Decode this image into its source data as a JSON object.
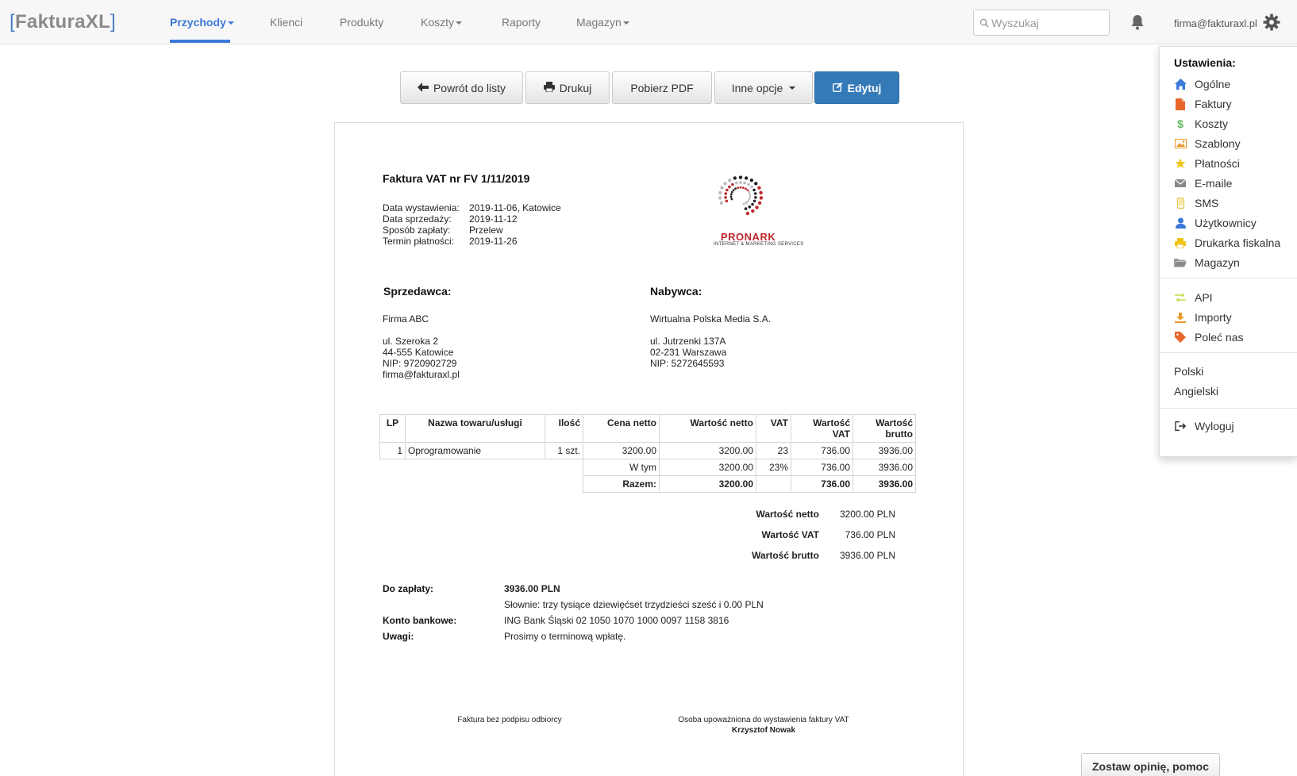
{
  "brand": {
    "open": "[",
    "name": "FakturaXL",
    "close": "]",
    "color": "#3b78d8"
  },
  "nav": {
    "items": [
      {
        "label": "Przychody",
        "dropdown": true,
        "active": true
      },
      {
        "label": "Klienci",
        "dropdown": false,
        "active": false
      },
      {
        "label": "Produkty",
        "dropdown": false,
        "active": false
      },
      {
        "label": "Koszty",
        "dropdown": true,
        "active": false
      },
      {
        "label": "Raporty",
        "dropdown": false,
        "active": false
      },
      {
        "label": "Magazyn",
        "dropdown": true,
        "active": false
      }
    ],
    "search_placeholder": "Wyszukaj",
    "bell_icon": "bell-icon",
    "user_email": "firma@fakturaxl.pl",
    "settings_icon": "gear-icon"
  },
  "toolbar": {
    "back": "Powrót do listy",
    "print": "Drukuj",
    "pdf": "Pobierz PDF",
    "more": "Inne opcje",
    "edit": "Edytuj"
  },
  "invoice": {
    "title": "Faktura VAT nr FV 1/11/2019",
    "meta": [
      {
        "label": "Data wystawienia:",
        "value": "2019-11-06, Katowice"
      },
      {
        "label": "Data sprzedaży:",
        "value": "2019-11-12"
      },
      {
        "label": "Sposób zapłaty:",
        "value": "Przelew"
      },
      {
        "label": "Termin płatności:",
        "value": "2019-11-26"
      }
    ],
    "logo": {
      "name": "PRONARK",
      "tagline": "INTERNET & MARKETING SERVICES"
    },
    "seller": {
      "heading": "Sprzedawca:",
      "name": "Firma ABC",
      "street": "ul. Szeroka 2",
      "city": "44-555 Katowice",
      "nip": "NIP: 9720902729",
      "email": "firma@fakturaxl.pl"
    },
    "buyer": {
      "heading": "Nabywca:",
      "name": "Wirtualna Polska Media S.A.",
      "street": "ul. Jutrzenki 137A",
      "city": "02-231 Warszawa",
      "nip": "NIP: 5272645593"
    },
    "table": {
      "headers": [
        "LP",
        "Nazwa towaru/usługi",
        "Ilość",
        "Cena netto",
        "Wartość netto",
        "VAT",
        "Wartość VAT",
        "Wartość brutto"
      ],
      "rows": [
        {
          "lp": "1",
          "name": "Oprogramowanie",
          "qty": "1 szt.",
          "price": "3200.00",
          "net": "3200.00",
          "vat": "23",
          "vat_value": "736.00",
          "gross": "3936.00"
        }
      ],
      "in_that": {
        "label": "W tym",
        "net": "3200.00",
        "vat": "23%",
        "vat_value": "736.00",
        "gross": "3936.00"
      },
      "total": {
        "label": "Razem:",
        "net": "3200.00",
        "vat": "",
        "vat_value": "736.00",
        "gross": "3936.00"
      }
    },
    "totals": [
      {
        "label": "Wartość netto",
        "value": "3200.00 PLN"
      },
      {
        "label": "Wartość VAT",
        "value": "736.00 PLN"
      },
      {
        "label": "Wartość brutto",
        "value": "3936.00 PLN"
      }
    ],
    "payment": {
      "due_label": "Do zapłaty:",
      "due_value": "3936.00 PLN",
      "words": "Słownie: trzy tysiące dziewięćset trzydzieści sześć i 0.00 PLN",
      "bank_label": "Konto bankowe:",
      "bank_value": "ING Bank Śląski 02 1050 1070 1000 0097 1158 3816",
      "notes_label": "Uwagi:",
      "notes_value": "Prosimy o terminową wpłatę."
    },
    "signatures": {
      "left": "Faktura bez podpisu odbiorcy",
      "right_label": "Osoba upoważniona do wystawienia faktury VAT",
      "right_name": "Krzysztof Nowak"
    }
  },
  "settings_menu": {
    "header": "Ustawienia:",
    "groups": [
      [
        {
          "label": "Ogólne",
          "icon": "home-icon",
          "color": "#3b78d8"
        },
        {
          "label": "Faktury",
          "icon": "file-icon",
          "color": "#e8662c"
        },
        {
          "label": "Koszty",
          "icon": "dollar-icon",
          "color": "#5cb85c"
        },
        {
          "label": "Szablony",
          "icon": "image-icon",
          "color": "#e89a2c"
        },
        {
          "label": "Płatności",
          "icon": "star-icon",
          "color": "#f0c419"
        },
        {
          "label": "E-maile",
          "icon": "envelope-icon",
          "color": "#888888"
        },
        {
          "label": "SMS",
          "icon": "phone-icon",
          "color": "#e0c040"
        },
        {
          "label": "Użytkownicy",
          "icon": "user-icon",
          "color": "#3b78d8"
        },
        {
          "label": "Drukarka fiskalna",
          "icon": "printer-icon",
          "color": "#f0c419"
        },
        {
          "label": "Magazyn",
          "icon": "folder-icon",
          "color": "#888888"
        }
      ],
      [
        {
          "label": "API",
          "icon": "swap-icon",
          "color": "#c8d84a"
        },
        {
          "label": "Importy",
          "icon": "download-icon",
          "color": "#e89a2c"
        },
        {
          "label": "Poleć nas",
          "icon": "tag-icon",
          "color": "#e8662c"
        }
      ]
    ],
    "languages": [
      "Polski",
      "Angielski"
    ],
    "logout": {
      "label": "Wyloguj",
      "icon": "logout-icon"
    }
  },
  "feedback_button": "Zostaw opinię, pomoc"
}
